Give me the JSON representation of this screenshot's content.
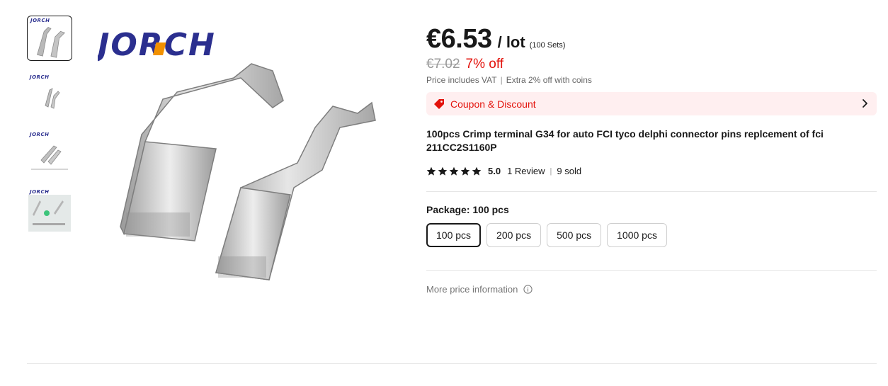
{
  "gallery": {
    "brand_logo": "JORCH",
    "thumbnails": [
      {
        "logo": "JORCH",
        "active": true
      },
      {
        "logo": "JORCH",
        "active": false
      },
      {
        "logo": "JORCH",
        "active": false
      },
      {
        "logo": "JORCH",
        "active": false
      }
    ]
  },
  "price": {
    "current": "€6.53",
    "unit": "/ lot",
    "sets_note": "(100 Sets)",
    "original": "€7.02",
    "discount": "7% off",
    "vat_note": "Price includes VAT",
    "separator": "|",
    "coins_note": "Extra 2% off with coins"
  },
  "coupon": {
    "label": "Coupon & Discount"
  },
  "product": {
    "title": "100pcs Crimp terminal G34 for auto FCI tyco delphi connector pins replcement of fci 211CC2S1160P"
  },
  "rating": {
    "stars": 5,
    "score": "5.0",
    "reviews": "1 Review",
    "divider": "|",
    "sold": "9 sold"
  },
  "package": {
    "label": "Package: 100 pcs",
    "options": [
      "100 pcs",
      "200 pcs",
      "500 pcs",
      "1000 pcs"
    ],
    "selected_index": 0
  },
  "more_price": {
    "label": "More price information"
  },
  "colors": {
    "accent_red": "#e3120b",
    "coupon_bg": "#ffeff0",
    "brand_blue": "#2b2f8f",
    "brand_orange": "#f29100",
    "star": "#191919"
  },
  "icons": {
    "coupon": "tag-icon",
    "chevron": "chevron-right-icon",
    "star": "star-icon",
    "info": "info-icon"
  }
}
